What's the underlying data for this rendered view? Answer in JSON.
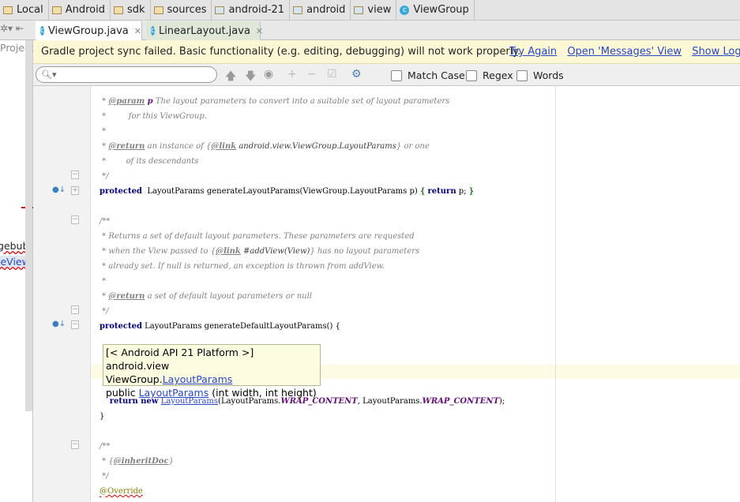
{
  "breadcrumbs": [
    {
      "label": "Local",
      "icon": "folder-icon"
    },
    {
      "label": "Android",
      "icon": "folder-icon"
    },
    {
      "label": "sdk",
      "icon": "folder-icon"
    },
    {
      "label": "sources",
      "icon": "folder-icon"
    },
    {
      "label": "android-21",
      "icon": "package-icon"
    },
    {
      "label": "android",
      "icon": "package-icon"
    },
    {
      "label": "view",
      "icon": "package-icon"
    },
    {
      "label": "ViewGroup",
      "icon": "class-icon"
    }
  ],
  "tabs": [
    {
      "label": "ViewGroup.java",
      "active": true
    },
    {
      "label": "LinearLayout.java",
      "active": false
    }
  ],
  "sidebar": {
    "title": "Project",
    "items": [
      "gebub",
      "leView"
    ]
  },
  "banner": {
    "message": "Gradle project sync failed. Basic functionality (e.g. editing, debugging) will not work properly.",
    "links": [
      "Try Again",
      "Open 'Messages' View",
      "Show Log in Ex"
    ]
  },
  "find": {
    "search_value": "",
    "options": [
      {
        "label": "Match Case",
        "checked": false
      },
      {
        "label": "Regex",
        "checked": false
      },
      {
        "label": "Words",
        "checked": false
      }
    ]
  },
  "code": [
    {
      "row": 0,
      "segs": [
        [
          "c",
          " * "
        ],
        [
          "t",
          "@param"
        ],
        [
          "f",
          " p"
        ],
        [
          "c",
          " The layout parameters to convert into a suitable set of layout parameters"
        ]
      ]
    },
    {
      "row": 1,
      "segs": [
        [
          "c",
          " *         for this ViewGroup."
        ]
      ]
    },
    {
      "row": 2,
      "segs": [
        [
          "c",
          " *"
        ]
      ]
    },
    {
      "row": 3,
      "segs": [
        [
          "c",
          " * "
        ],
        [
          "t",
          "@return"
        ],
        [
          "c",
          " an instance of {"
        ],
        [
          "t",
          "@link"
        ],
        [
          "r",
          " android.view.ViewGroup.LayoutParams"
        ],
        [
          "c",
          "} or one"
        ]
      ]
    },
    {
      "row": 4,
      "segs": [
        [
          "c",
          " *        of its descendants"
        ]
      ]
    },
    {
      "row": 5,
      "segs": [
        [
          "c",
          " */"
        ]
      ]
    },
    {
      "row": 6,
      "segs": [
        [
          "k",
          "protected"
        ],
        [
          "",
          "  LayoutParams generateLayoutParams(ViewGroup.LayoutParams p) "
        ],
        [
          "g",
          "{"
        ],
        [
          "",
          " "
        ],
        [
          "k",
          "return"
        ],
        [
          "",
          " p; "
        ],
        [
          "g",
          "}"
        ]
      ]
    },
    {
      "row": 8,
      "segs": [
        [
          "c",
          "/**"
        ]
      ]
    },
    {
      "row": 9,
      "segs": [
        [
          "c",
          " * Returns a set of default layout parameters. These parameters are requested"
        ]
      ]
    },
    {
      "row": 10,
      "segs": [
        [
          "c",
          " * when the View passed to {"
        ],
        [
          "t",
          "@link"
        ],
        [
          "r",
          " #addView(View)"
        ],
        [
          "c",
          "} has no layout parameters"
        ]
      ]
    },
    {
      "row": 11,
      "segs": [
        [
          "c",
          " * already set. If null is returned, an exception is thrown from addView."
        ]
      ]
    },
    {
      "row": 12,
      "segs": [
        [
          "c",
          " *"
        ]
      ]
    },
    {
      "row": 13,
      "segs": [
        [
          "c",
          " * "
        ],
        [
          "t",
          "@return"
        ],
        [
          "c",
          " a set of default layout parameters or null"
        ]
      ]
    },
    {
      "row": 14,
      "segs": [
        [
          "c",
          " */"
        ]
      ]
    },
    {
      "row": 15,
      "segs": [
        [
          "k",
          "protected"
        ],
        [
          "",
          " LayoutParams generateDefaultLayoutParams() {"
        ]
      ]
    },
    {
      "row": 20,
      "segs": [
        [
          "",
          "    "
        ],
        [
          "k",
          "return new"
        ],
        [
          "",
          " "
        ],
        [
          "l",
          "LayoutParams"
        ],
        [
          "",
          "(LayoutParams."
        ],
        [
          "f",
          "WRAP_CONTENT"
        ],
        [
          "",
          ", LayoutParams."
        ],
        [
          "f",
          "WRAP_CONTENT"
        ],
        [
          "",
          ");"
        ]
      ]
    },
    {
      "row": 21,
      "segs": [
        [
          "",
          "}"
        ]
      ]
    },
    {
      "row": 23,
      "segs": [
        [
          "c",
          "/**"
        ]
      ]
    },
    {
      "row": 24,
      "segs": [
        [
          "c",
          " * {"
        ],
        [
          "t",
          "@inheritDoc"
        ],
        [
          "c",
          "}"
        ]
      ]
    },
    {
      "row": 25,
      "segs": [
        [
          "c",
          " */"
        ]
      ]
    },
    {
      "row": 26,
      "segs": [
        [
          "a",
          "@Override"
        ]
      ]
    }
  ],
  "tooltip": {
    "line1": "[< Android API 21 Platform >] android.view",
    "line2_prefix": "ViewGroup.",
    "line2_link": "LayoutParams",
    "line3_prefix": "public ",
    "line3_link": "LayoutParams",
    "line3_suffix": " (int width, int height)"
  }
}
